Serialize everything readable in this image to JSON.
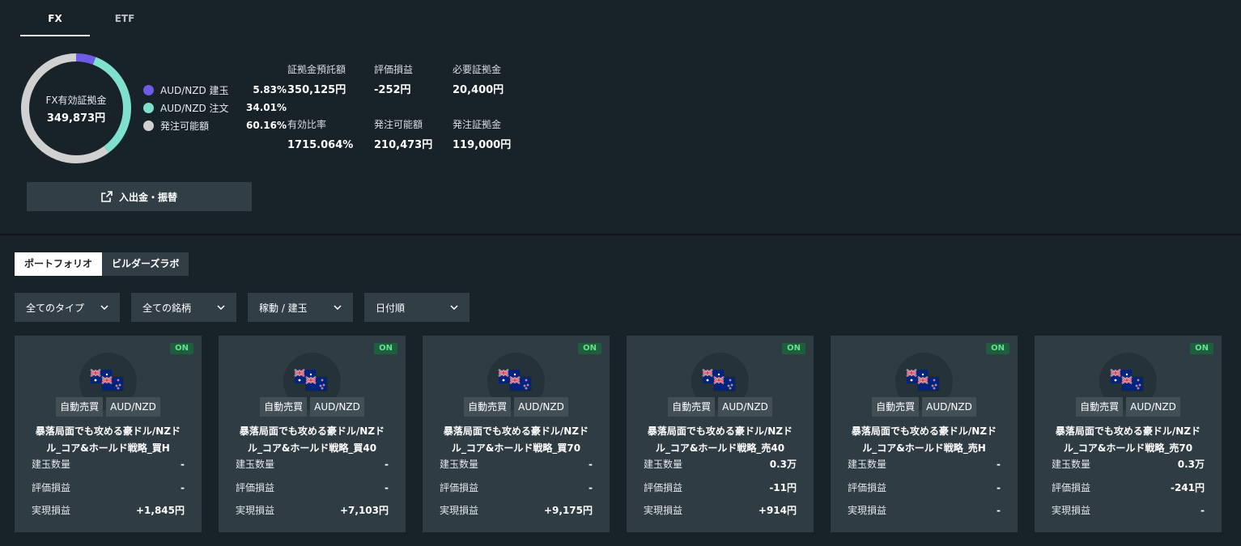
{
  "top_tabs": [
    {
      "label": "FX"
    },
    {
      "label": "ETF"
    }
  ],
  "donut": {
    "label": "FX有効証拠金",
    "value": "349,873円",
    "segments": [
      {
        "fraction": 0.0583,
        "color": "#6c5ce7"
      },
      {
        "fraction": 0.3401,
        "color": "#7ee0cd"
      },
      {
        "fraction": 0.6016,
        "color": "#d0d0d0"
      }
    ]
  },
  "legend": [
    {
      "name": "AUD/NZD 建玉",
      "pct": "5.83%",
      "color": "#6c5ce7"
    },
    {
      "name": "AUD/NZD 注文",
      "pct": "34.01%",
      "color": "#7ee0cd"
    },
    {
      "name": "発注可能額",
      "pct": "60.16%",
      "color": "#d0d0d0"
    }
  ],
  "stats": [
    {
      "label": "証拠金預託額",
      "value": "350,125円"
    },
    {
      "label": "評価損益",
      "value": "-252円"
    },
    {
      "label": "必要証拠金",
      "value": "20,400円"
    },
    {
      "label": "有効比率",
      "value": "1715.064%"
    },
    {
      "label": "発注可能額",
      "value": "210,473円"
    },
    {
      "label": "発注証拠金",
      "value": "119,000円"
    }
  ],
  "deposit_button": {
    "label": "入出金・振替"
  },
  "sub_tabs": [
    {
      "label": "ポートフォリオ"
    },
    {
      "label": "ビルダーズラボ"
    }
  ],
  "filters": [
    {
      "label": "全てのタイプ"
    },
    {
      "label": "全ての銘柄"
    },
    {
      "label": "稼動 / 建玉"
    },
    {
      "label": "日付順"
    }
  ],
  "metric_labels": {
    "position": "建玉数量",
    "unrealized": "評価損益",
    "realized": "実現損益"
  },
  "cards": [
    {
      "status": "ON",
      "type": "自動売買",
      "pair": "AUD/NZD",
      "title": "暴落局面でも攻める豪ドル/NZドル_コア&ホールド戦略_買H",
      "position": "-",
      "unrealized": "-",
      "realized": "+1,845円"
    },
    {
      "status": "ON",
      "type": "自動売買",
      "pair": "AUD/NZD",
      "title": "暴落局面でも攻める豪ドル/NZドル_コア&ホールド戦略_買40",
      "position": "-",
      "unrealized": "-",
      "realized": "+7,103円"
    },
    {
      "status": "ON",
      "type": "自動売買",
      "pair": "AUD/NZD",
      "title": "暴落局面でも攻める豪ドル/NZドル_コア&ホールド戦略_買70",
      "position": "-",
      "unrealized": "-",
      "realized": "+9,175円"
    },
    {
      "status": "ON",
      "type": "自動売買",
      "pair": "AUD/NZD",
      "title": "暴落局面でも攻める豪ドル/NZドル_コア&ホールド戦略_売40",
      "position": "0.3万",
      "unrealized": "-11円",
      "realized": "+914円"
    },
    {
      "status": "ON",
      "type": "自動売買",
      "pair": "AUD/NZD",
      "title": "暴落局面でも攻める豪ドル/NZドル_コア&ホールド戦略_売H",
      "position": "-",
      "unrealized": "-",
      "realized": "-"
    },
    {
      "status": "ON",
      "type": "自動売買",
      "pair": "AUD/NZD",
      "title": "暴落局面でも攻める豪ドル/NZドル_コア&ホールド戦略_売70",
      "position": "0.3万",
      "unrealized": "-241円",
      "realized": "-"
    }
  ]
}
